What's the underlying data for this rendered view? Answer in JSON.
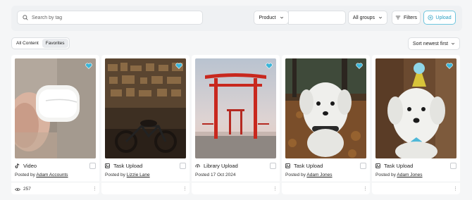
{
  "search": {
    "placeholder": "Search by tag"
  },
  "toolbar": {
    "product_label": "Product",
    "groups_label": "All groups",
    "filters_label": "Filters",
    "upload_label": "Upload"
  },
  "tabs": [
    {
      "label": "All Content"
    },
    {
      "label": "Favorites"
    }
  ],
  "sort": {
    "label": "Sort newest first"
  },
  "colors": {
    "accent": "#2a9fc2",
    "heart": "#3ab6d9"
  },
  "cards": [
    {
      "type_icon": "tiktok-icon",
      "title": "Video",
      "meta_prefix": "Posted by",
      "author": "Adam Accounts",
      "views": "257"
    },
    {
      "type_icon": "task-image-icon",
      "title": "Task Upload",
      "meta_prefix": "Posted by",
      "author": "Lizzie Lane"
    },
    {
      "type_icon": "cloud-upload-icon",
      "title": "Library Upload",
      "meta_prefix": "Posted 17 Oct 2024"
    },
    {
      "type_icon": "task-image-icon",
      "title": "Task Upload",
      "meta_prefix": "Posted by",
      "author": "Adam Jones"
    },
    {
      "type_icon": "task-image-icon",
      "title": "Task Upload",
      "meta_prefix": "Posted by",
      "author": "Adam Jones"
    }
  ]
}
